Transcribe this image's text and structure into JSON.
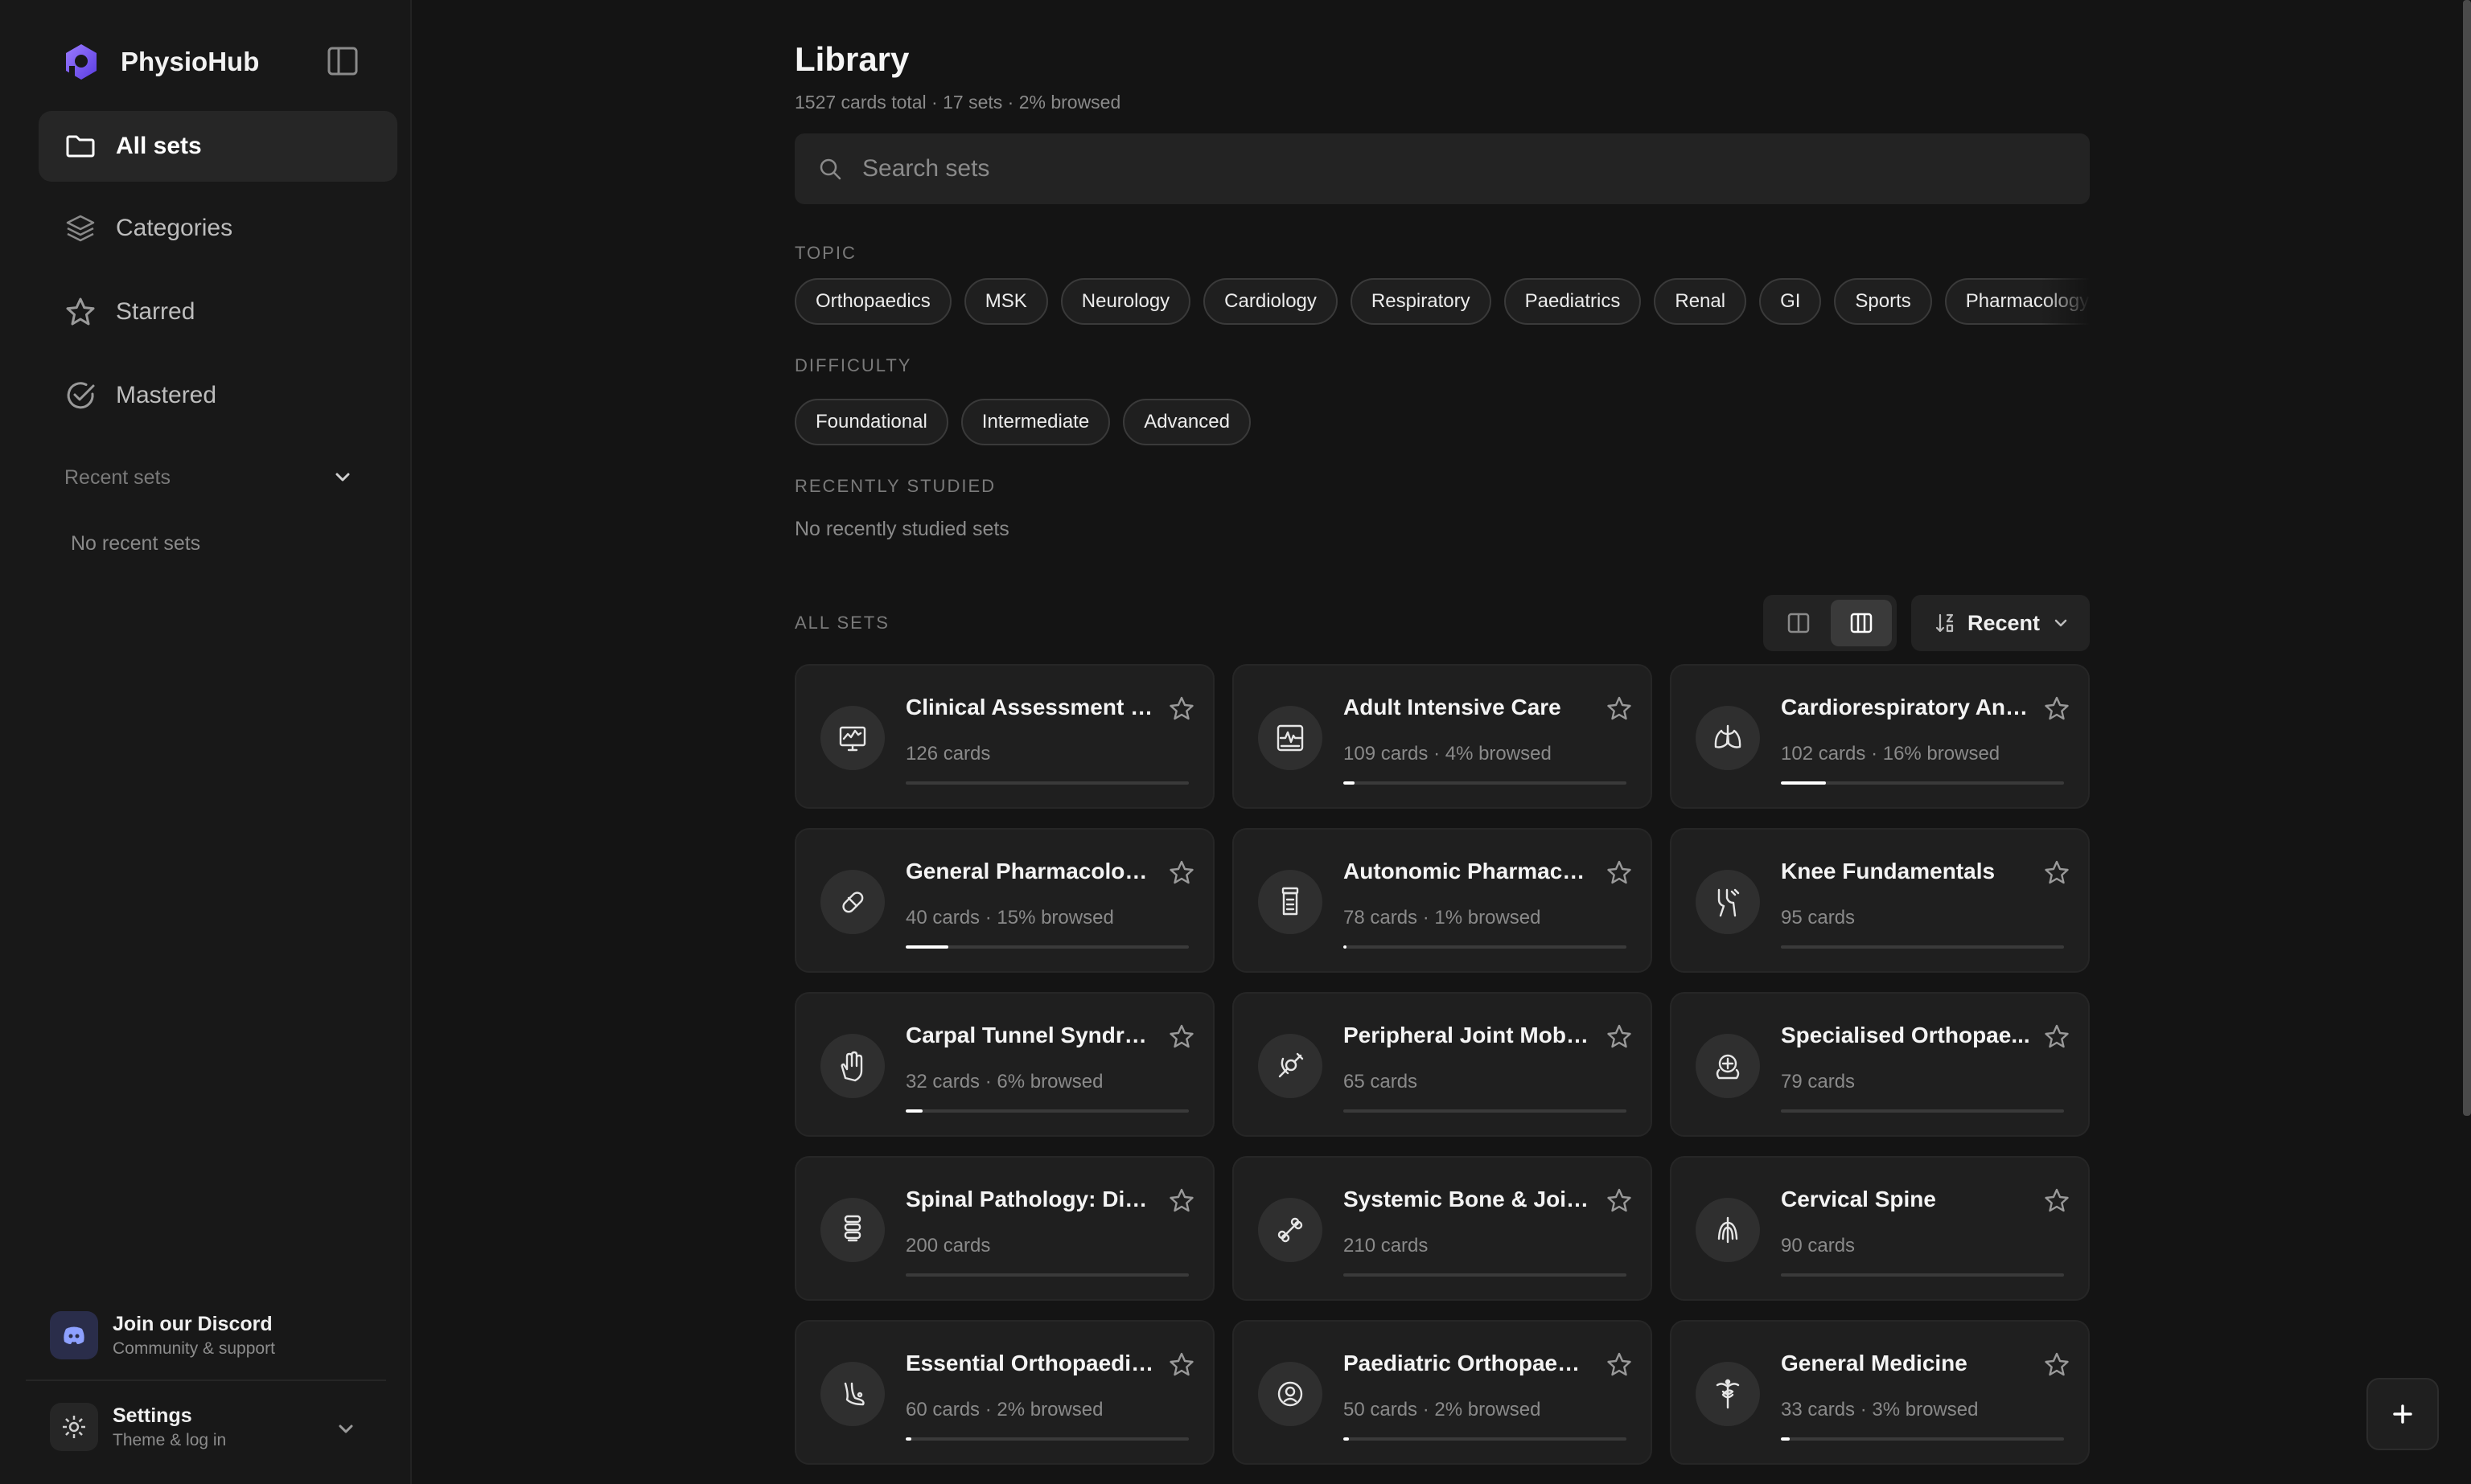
{
  "app": {
    "name": "PhysioHub",
    "accent": "#7c5cff"
  },
  "sidebar": {
    "items": [
      {
        "label": "All sets",
        "icon": "folder-icon",
        "active": true
      },
      {
        "label": "Categories",
        "icon": "layers-icon"
      },
      {
        "label": "Starred",
        "icon": "star-icon"
      },
      {
        "label": "Mastered",
        "icon": "check-circle-icon"
      }
    ],
    "recent_label": "Recent sets",
    "no_recent": "No recent sets",
    "discord": {
      "title": "Join our Discord",
      "subtitle": "Community & support"
    },
    "settings": {
      "title": "Settings",
      "subtitle": "Theme & log in"
    }
  },
  "main": {
    "title": "Library",
    "summary": "1527 cards total · 17 sets · 2% browsed",
    "search_placeholder": "Search sets",
    "topic_label": "TOPIC",
    "topics": [
      "Orthopaedics",
      "MSK",
      "Neurology",
      "Cardiology",
      "Respiratory",
      "Paediatrics",
      "Renal",
      "GI",
      "Sports",
      "Pharmacology"
    ],
    "difficulty_label": "DIFFICULTY",
    "difficulties": [
      "Foundational",
      "Intermediate",
      "Advanced"
    ],
    "recent_label": "RECENTLY STUDIED",
    "recent_empty": "No recently studied sets",
    "all_sets_label": "ALL SETS",
    "sort_label": "Recent",
    "sets": [
      {
        "title": "Clinical Assessment of...",
        "meta": "126 cards",
        "progress": 0,
        "icon": "monitor-icon"
      },
      {
        "title": "Adult Intensive Care",
        "meta": "109 cards · 4% browsed",
        "progress": 4,
        "icon": "ecg-monitor-icon"
      },
      {
        "title": "Cardiorespiratory Ana...",
        "meta": "102 cards · 16% browsed",
        "progress": 16,
        "icon": "lungs-icon"
      },
      {
        "title": "General Pharmacolog...",
        "meta": "40 cards · 15% browsed",
        "progress": 15,
        "icon": "pill-icon"
      },
      {
        "title": "Autonomic Pharmaco...",
        "meta": "78 cards · 1% browsed",
        "progress": 1,
        "icon": "medicine-bottle-icon"
      },
      {
        "title": "Knee Fundamentals",
        "meta": "95 cards",
        "progress": 0,
        "icon": "knee-icon"
      },
      {
        "title": "Carpal Tunnel Syndro...",
        "meta": "32 cards · 6% browsed",
        "progress": 6,
        "icon": "hand-icon"
      },
      {
        "title": "Peripheral Joint Mobil...",
        "meta": "65 cards",
        "progress": 0,
        "icon": "joint-icon"
      },
      {
        "title": "Specialised Orthopae...",
        "meta": "79 cards",
        "progress": 0,
        "icon": "brain-gear-icon"
      },
      {
        "title": "Spinal Pathology: Disc...",
        "meta": "200 cards",
        "progress": 0,
        "icon": "spine-icon"
      },
      {
        "title": "Systemic Bone & Joint...",
        "meta": "210 cards",
        "progress": 0,
        "icon": "bone-icon"
      },
      {
        "title": "Cervical Spine",
        "meta": "90 cards",
        "progress": 0,
        "icon": "ribcage-icon"
      },
      {
        "title": "Essential Orthopaedics",
        "meta": "60 cards · 2% browsed",
        "progress": 2,
        "icon": "foot-icon"
      },
      {
        "title": "Paediatric Orthopaedics",
        "meta": "50 cards · 2% browsed",
        "progress": 2,
        "icon": "baby-icon"
      },
      {
        "title": "General Medicine",
        "meta": "33 cards · 3% browsed",
        "progress": 3,
        "icon": "caduceus-icon"
      }
    ]
  }
}
